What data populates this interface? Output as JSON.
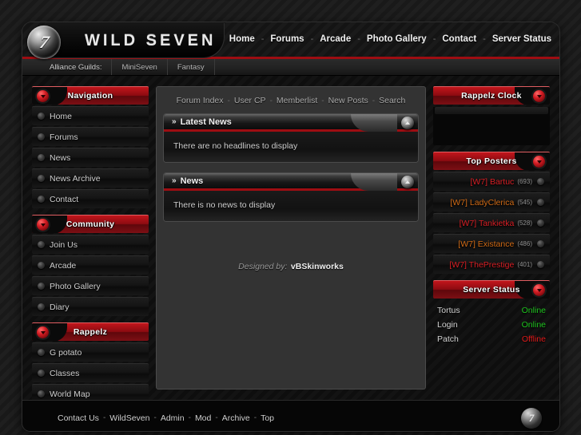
{
  "header": {
    "logo_glyph": "7",
    "site_title": "WILD SEVEN",
    "nav": [
      {
        "label": "Home"
      },
      {
        "label": "Forums"
      },
      {
        "label": "Arcade"
      },
      {
        "label": "Photo Gallery"
      },
      {
        "label": "Contact"
      },
      {
        "label": "Server Status"
      }
    ],
    "nav_separator": "-"
  },
  "subnav": {
    "label": "Alliance Guilds:",
    "items": [
      {
        "label": "MiniSeven"
      },
      {
        "label": "Fantasy"
      }
    ]
  },
  "sidebar_left": {
    "panels": [
      {
        "title": "Navigation",
        "items": [
          {
            "label": "Home"
          },
          {
            "label": "Forums"
          },
          {
            "label": "News"
          },
          {
            "label": "News Archive"
          },
          {
            "label": "Contact"
          }
        ]
      },
      {
        "title": "Community",
        "items": [
          {
            "label": "Join Us"
          },
          {
            "label": "Arcade"
          },
          {
            "label": "Photo Gallery"
          },
          {
            "label": "Diary"
          }
        ]
      },
      {
        "title": "Rappelz",
        "items": [
          {
            "label": "G potato"
          },
          {
            "label": "Classes"
          },
          {
            "label": "World Map"
          }
        ]
      }
    ]
  },
  "main": {
    "breadcrumb": {
      "separator": "-",
      "items": [
        {
          "label": "Forum Index"
        },
        {
          "label": "User CP"
        },
        {
          "label": "Memberlist"
        },
        {
          "label": "New Posts"
        },
        {
          "label": "Search"
        }
      ]
    },
    "blocks": [
      {
        "arrows": "»",
        "title": "Latest News",
        "message": "There are no headlines to display"
      },
      {
        "arrows": "»",
        "title": "News",
        "message": "There is no news to display"
      }
    ],
    "credit": {
      "prefix": "Designed by:",
      "name": "vBSkinworks"
    }
  },
  "sidebar_right": {
    "clock": {
      "title": "Rappelz Clock"
    },
    "top_posters": {
      "title": "Top Posters",
      "items": [
        {
          "name": "[W7] Bartuc",
          "count": "(693)",
          "color": "#d81f25"
        },
        {
          "name": "[W7] LadyClerica",
          "count": "(545)",
          "color": "#cf6a16"
        },
        {
          "name": "[W7] Tankietka",
          "count": "(528)",
          "color": "#d81f25"
        },
        {
          "name": "[W7] Existance",
          "count": "(486)",
          "color": "#cf6a16"
        },
        {
          "name": "[W7] ThePrestige",
          "count": "(401)",
          "color": "#d81f25"
        }
      ]
    },
    "server_status": {
      "title": "Server Status",
      "rows": [
        {
          "name": "Tortus",
          "status": "Online",
          "color": "#1ec41e"
        },
        {
          "name": "Login",
          "status": "Online",
          "color": "#1ec41e"
        },
        {
          "name": "Patch",
          "status": "Offline",
          "color": "#e01b1b"
        }
      ]
    }
  },
  "footer": {
    "separator": "-",
    "links": [
      {
        "label": "Contact Us"
      },
      {
        "label": "WildSeven"
      },
      {
        "label": "Admin"
      },
      {
        "label": "Mod"
      },
      {
        "label": "Archive"
      },
      {
        "label": "Top"
      }
    ],
    "logo_glyph": "7"
  },
  "colors": {
    "accent_red": "#9e0d12",
    "panel_red": "#c2161c",
    "content_bg": "#333333",
    "page_bg": "#1c1c1c"
  }
}
